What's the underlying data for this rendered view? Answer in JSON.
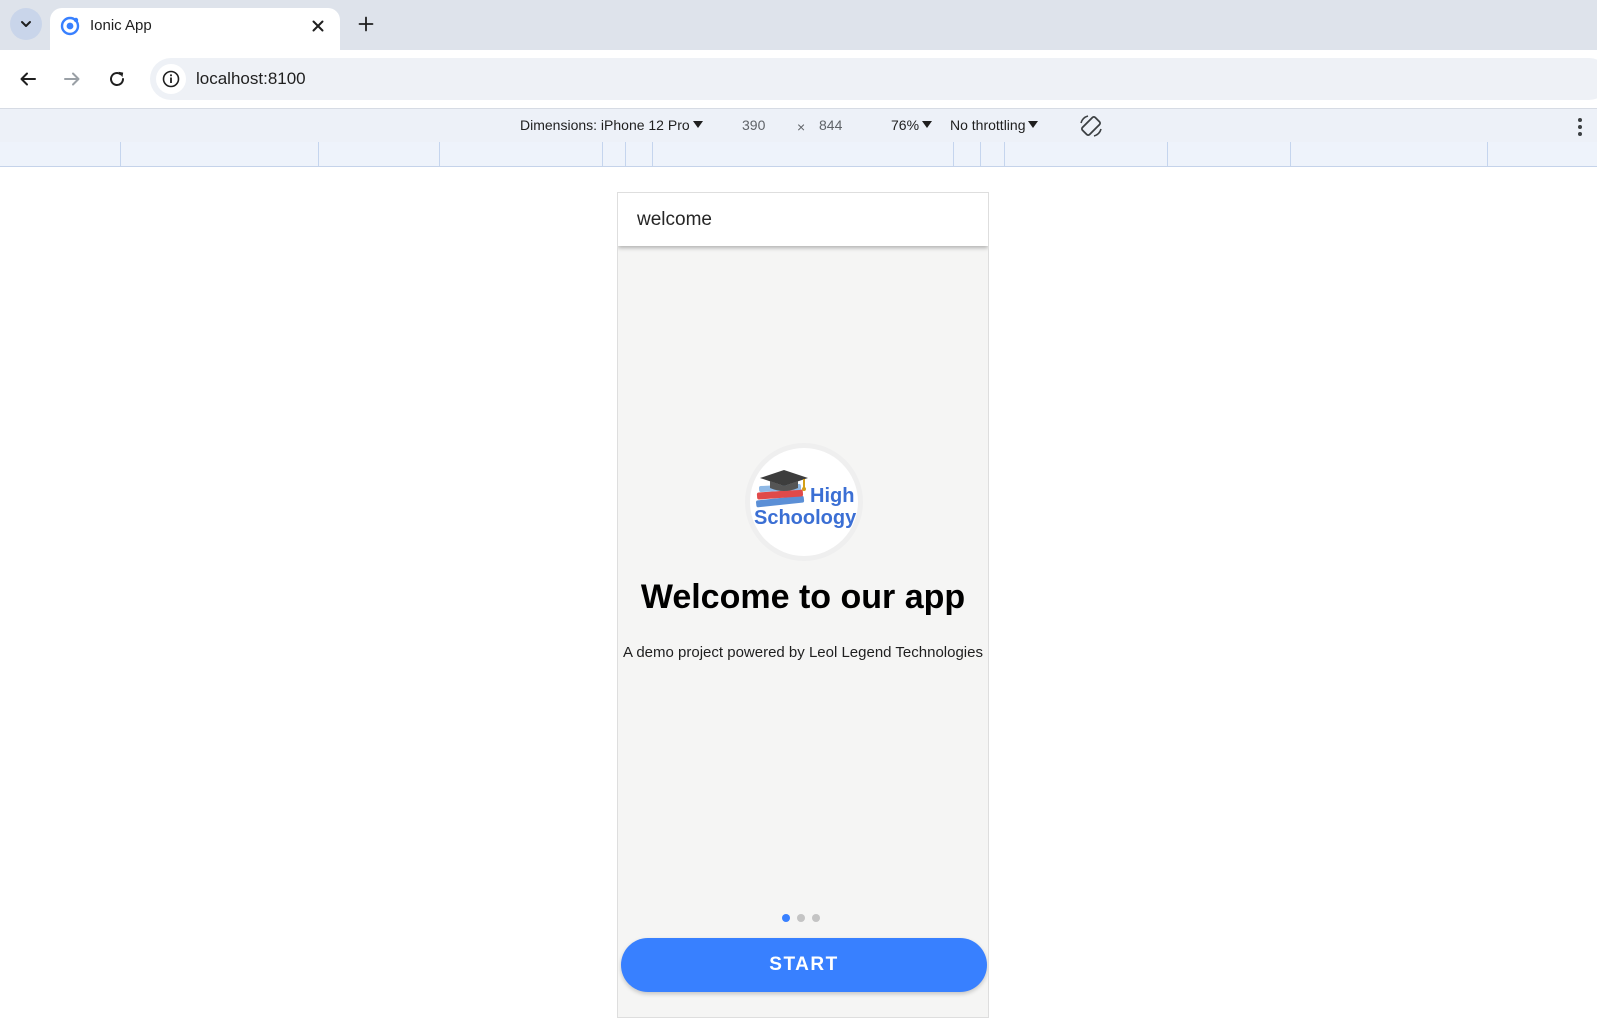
{
  "browser": {
    "tab_title": "Ionic App",
    "url": "localhost:8100"
  },
  "device_toolbar": {
    "dimensions_label": "Dimensions: iPhone 12 Pro",
    "width": "390",
    "times": "×",
    "height": "844",
    "zoom": "76%",
    "throttling": "No throttling"
  },
  "app": {
    "header_title": "welcome",
    "logo": {
      "word1": "High",
      "word2": "Schoology"
    },
    "title": "Welcome to our app",
    "subtitle": "A demo project powered by Leol Legend Technologies",
    "pager": {
      "count": 3,
      "active_index": 0
    },
    "start_label": "START"
  },
  "colors": {
    "primary": "#3880ff",
    "content_bg": "#f5f5f4",
    "logo_text": "#3b6fd4"
  }
}
